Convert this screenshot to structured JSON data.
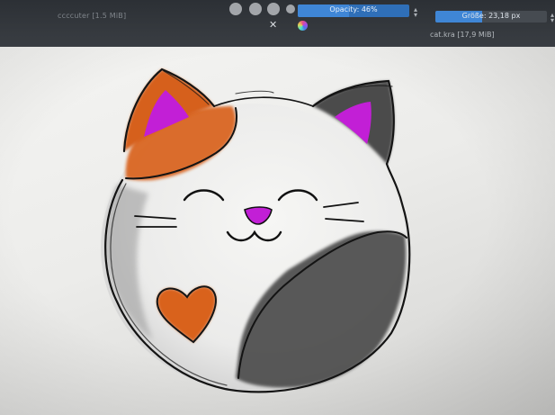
{
  "toolbar": {
    "document_tab": "ccccuter [1.5 MiB]",
    "opacity_label": "Opacity: 46%",
    "opacity_value": 0.46,
    "size_label": "Größe: 23,18 px",
    "size_fill": 0.42,
    "file_tab": "cat.kra [17,9 MiB]",
    "close_glyph": "✕"
  },
  "canvas": {
    "drawing": "calico-cat-face",
    "colors": {
      "orange": "#d9621f",
      "purple": "#c21fd6",
      "gray": "#4b4b4b",
      "paper": "#f2f2f0"
    }
  }
}
